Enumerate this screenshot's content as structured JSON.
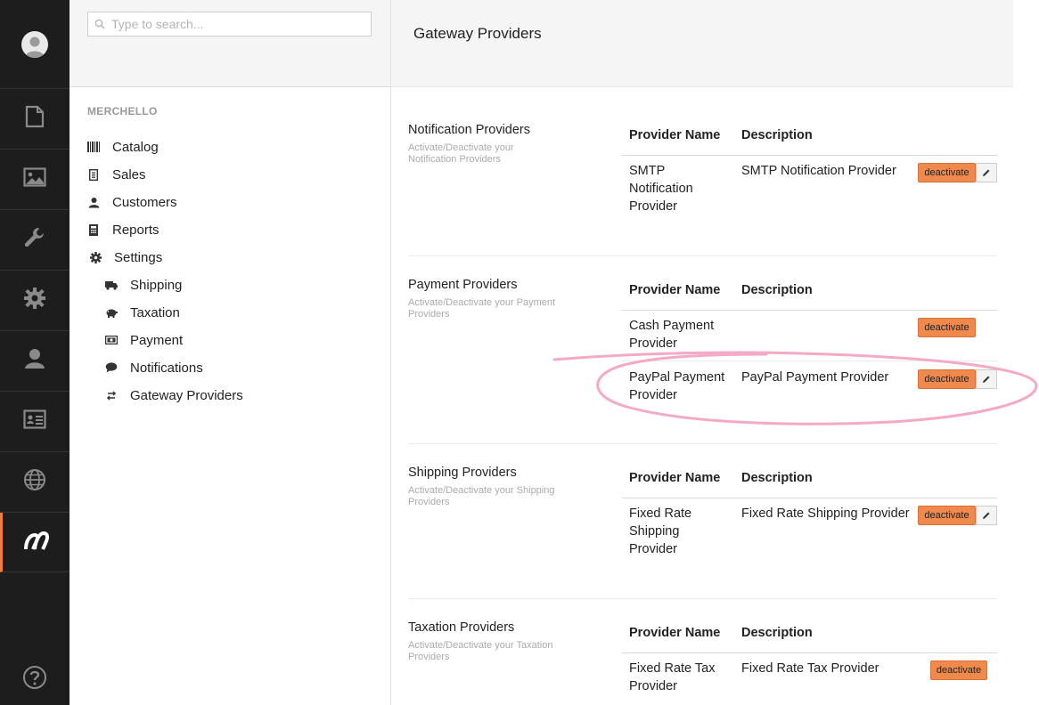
{
  "rail": {
    "icons": [
      "avatar-icon",
      "content-icon",
      "media-icon",
      "settings-wrench-icon",
      "developer-gear-icon",
      "users-icon",
      "members-icon",
      "translation-globe-icon",
      "merchello-icon",
      "help-icon"
    ],
    "accent": "#f07d3a",
    "background": "#1d1d1d"
  },
  "tree": {
    "search_placeholder": "Type to search...",
    "section_title": "MERCHELLO",
    "items": [
      {
        "label": "Catalog",
        "icon": "barcode-icon"
      },
      {
        "label": "Sales",
        "icon": "receipt-icon"
      },
      {
        "label": "Customers",
        "icon": "user-icon"
      },
      {
        "label": "Reports",
        "icon": "calculator-icon"
      },
      {
        "label": "Settings",
        "icon": "gear-icon"
      }
    ],
    "settings_children": [
      {
        "label": "Shipping",
        "icon": "truck-icon"
      },
      {
        "label": "Taxation",
        "icon": "piggy-bank-icon"
      },
      {
        "label": "Payment",
        "icon": "money-icon"
      },
      {
        "label": "Notifications",
        "icon": "chat-bubble-icon"
      },
      {
        "label": "Gateway Providers",
        "icon": "swap-arrows-icon"
      }
    ]
  },
  "main": {
    "title": "Gateway Providers",
    "col_name": "Provider Name",
    "col_desc": "Description",
    "deactivate_label": "deactivate",
    "button_color": "#ef8a4c",
    "sections": [
      {
        "name": "Notification Providers",
        "desc": "Activate/Deactivate your Notification Providers",
        "rows": [
          {
            "name": "SMTP Notification Provider",
            "desc": "SMTP Notification Provider",
            "editable": true
          }
        ]
      },
      {
        "name": "Payment Providers",
        "desc": "Activate/Deactivate your Payment Providers",
        "rows": [
          {
            "name": "Cash Payment Provider",
            "desc": "",
            "editable": false
          },
          {
            "name": "PayPal Payment Provider",
            "desc": "PayPal Payment Provider",
            "editable": true
          }
        ]
      },
      {
        "name": "Shipping Providers",
        "desc": "Activate/Deactivate your Shipping Providers",
        "rows": [
          {
            "name": "Fixed Rate Shipping Provider",
            "desc": "Fixed Rate Shipping Provider",
            "editable": true
          }
        ]
      },
      {
        "name": "Taxation Providers",
        "desc": "Activate/Deactivate your Taxation Providers",
        "rows": [
          {
            "name": "Fixed Rate Tax Provider",
            "desc": "Fixed Rate Tax Provider",
            "editable": false
          }
        ]
      }
    ]
  },
  "annotation": {
    "color": "#f4a9c4",
    "shape": "hand-drawn ellipse around PayPal Payment Provider row"
  }
}
